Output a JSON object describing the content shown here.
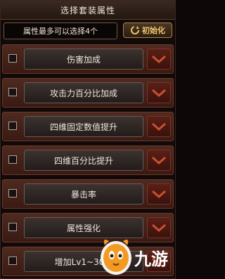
{
  "header": {
    "title": "选择套装属性"
  },
  "info": {
    "text": "属性最多可以选择4个",
    "reset_label": "初始化"
  },
  "attributes": [
    {
      "label": "伤害加成",
      "checked": false
    },
    {
      "label": "攻击力百分比加成",
      "checked": false
    },
    {
      "label": "四维固定数值提升",
      "checked": false
    },
    {
      "label": "四维百分比提升",
      "checked": false
    },
    {
      "label": "暴击率",
      "checked": false
    },
    {
      "label": "属性强化",
      "checked": false
    },
    {
      "label": "增加Lv1~30的",
      "checked": false
    }
  ],
  "watermark": {
    "text": "九游"
  },
  "colors": {
    "accent_gold": "#f2c66e",
    "row_red": "#4e2a20",
    "chevron_red": "#c8502f"
  }
}
